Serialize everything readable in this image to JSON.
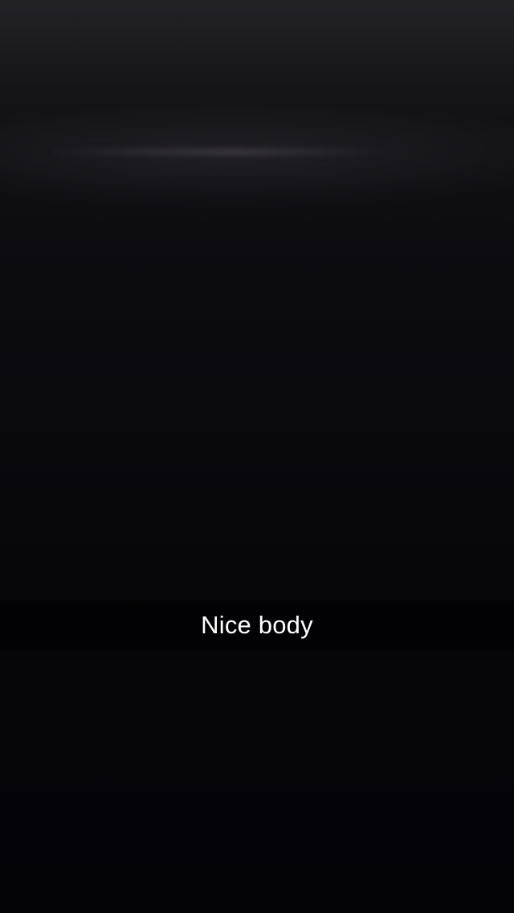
{
  "snap": {
    "caption": "Nice body"
  },
  "colors": {
    "background": "#060608",
    "caption_bar": "#000000",
    "caption_text": "#ffffff"
  }
}
